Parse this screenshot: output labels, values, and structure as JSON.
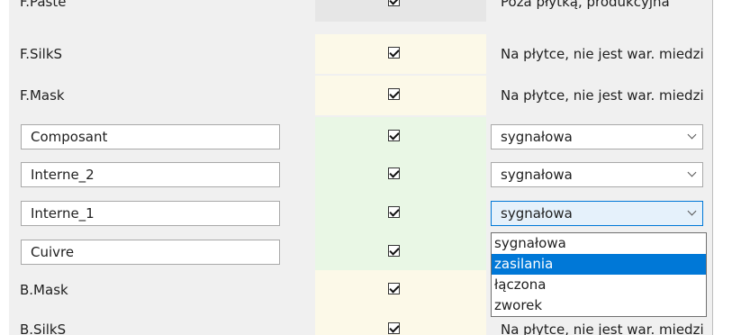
{
  "rows": [
    {
      "name": "F.Paste",
      "type": "Poza płytką, produkcyjna"
    },
    {
      "name": "F.SilkS",
      "type": "Na płytce, nie jest war. miedzi"
    },
    {
      "name": "F.Mask",
      "type": "Na płytce, nie jest war. miedzi"
    },
    {
      "name": "Composant",
      "type": "sygnałowa"
    },
    {
      "name": "Interne_2",
      "type": "sygnałowa"
    },
    {
      "name": "Interne_1",
      "type": "sygnałowa"
    },
    {
      "name": "Cuivre",
      "type": ""
    },
    {
      "name": "B.Mask",
      "type": ""
    },
    {
      "name": "B.SilkS",
      "type": "Na płytce, nie jest war. miedzi"
    }
  ],
  "dropdown": {
    "options": [
      "sygnałowa",
      "zasilania",
      "łączona",
      "zworek"
    ],
    "highlighted": "zasilania"
  },
  "colors": {
    "cream": "#fcf9e8",
    "green": "#e9f7e5",
    "selection": "#0078d7"
  }
}
